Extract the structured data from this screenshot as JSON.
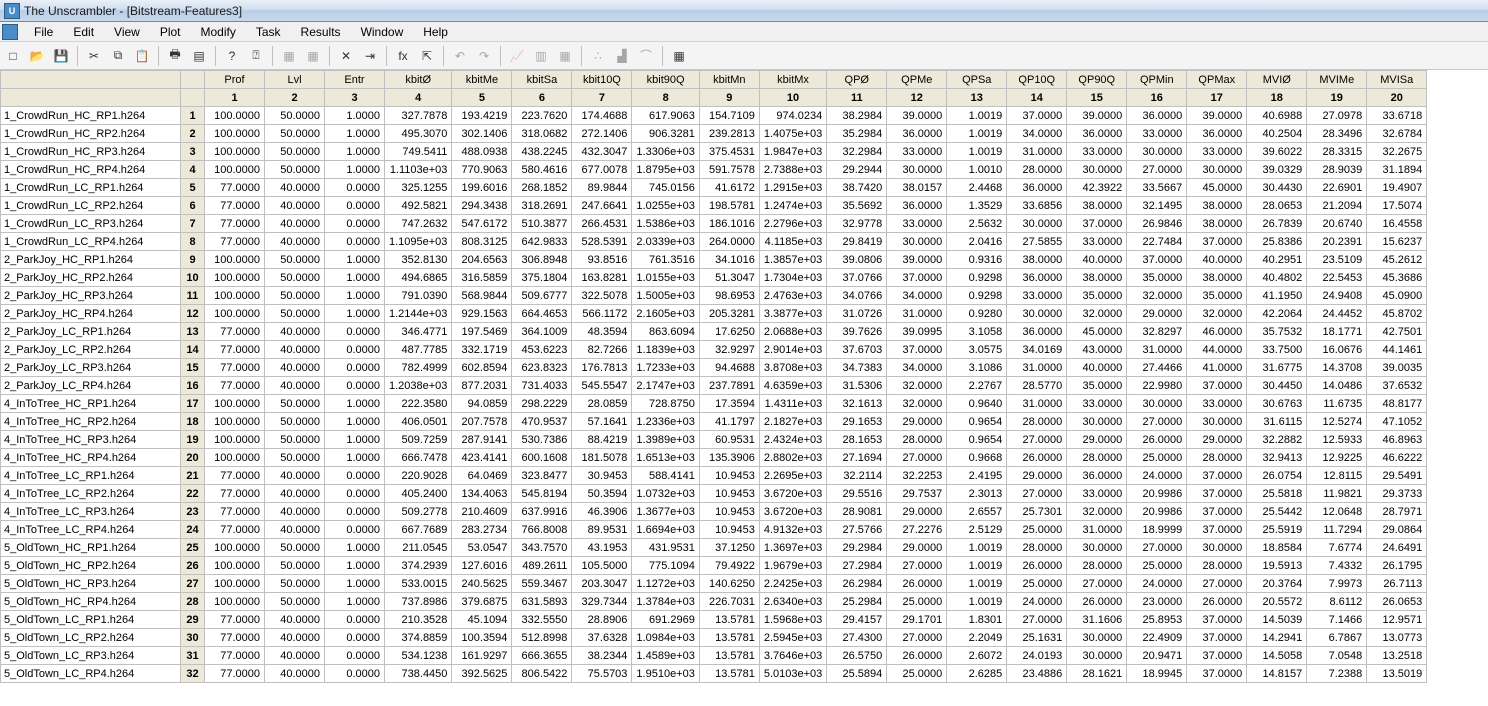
{
  "app": {
    "title": "The Unscrambler - [Bitstream-Features3]"
  },
  "menu": [
    "File",
    "Edit",
    "View",
    "Plot",
    "Modify",
    "Task",
    "Results",
    "Window",
    "Help"
  ],
  "toolbar_icons": [
    {
      "name": "new-icon",
      "glyph": "□"
    },
    {
      "name": "open-icon",
      "glyph": "📂"
    },
    {
      "name": "save-icon",
      "glyph": "💾"
    },
    {
      "name": "sep"
    },
    {
      "name": "cut-icon",
      "glyph": "✂"
    },
    {
      "name": "copy-icon",
      "glyph": "⧉"
    },
    {
      "name": "paste-icon",
      "glyph": "📋"
    },
    {
      "name": "sep"
    },
    {
      "name": "print-icon",
      "glyph": "🖶"
    },
    {
      "name": "print-preview-icon",
      "glyph": "▤"
    },
    {
      "name": "sep"
    },
    {
      "name": "help-icon",
      "glyph": "?"
    },
    {
      "name": "context-help-icon",
      "glyph": "⍰"
    },
    {
      "name": "sep"
    },
    {
      "name": "grid-a-icon",
      "glyph": "▦",
      "disabled": true
    },
    {
      "name": "grid-b-icon",
      "glyph": "▦",
      "disabled": true
    },
    {
      "name": "sep"
    },
    {
      "name": "delete-x-icon",
      "glyph": "✕"
    },
    {
      "name": "insert-col-icon",
      "glyph": "⇥"
    },
    {
      "name": "sep"
    },
    {
      "name": "fx-icon",
      "glyph": "fx"
    },
    {
      "name": "export-icon",
      "glyph": "⇱"
    },
    {
      "name": "sep"
    },
    {
      "name": "undo-icon",
      "glyph": "↶",
      "disabled": true
    },
    {
      "name": "redo-icon",
      "glyph": "↷",
      "disabled": true
    },
    {
      "name": "sep"
    },
    {
      "name": "chart-line-icon",
      "glyph": "📈",
      "disabled": true
    },
    {
      "name": "chart-bar-icon",
      "glyph": "▥",
      "disabled": true
    },
    {
      "name": "chart-matrix-icon",
      "glyph": "▦",
      "disabled": true
    },
    {
      "name": "sep"
    },
    {
      "name": "scatter-icon",
      "glyph": "∴",
      "disabled": true
    },
    {
      "name": "histogram-icon",
      "glyph": "▟",
      "disabled": true
    },
    {
      "name": "normal-icon",
      "glyph": "⌒",
      "disabled": true
    },
    {
      "name": "sep"
    },
    {
      "name": "table-select-icon",
      "glyph": "▦"
    }
  ],
  "columns": [
    {
      "name": "Prof",
      "idx": "1",
      "w": "col-w-mid"
    },
    {
      "name": "Lvl",
      "idx": "2",
      "w": "col-w-mid"
    },
    {
      "name": "Entr",
      "idx": "3",
      "w": "col-w-mid"
    },
    {
      "name": "kbitØ",
      "idx": "4",
      "w": "col-w-wide"
    },
    {
      "name": "kbitMe",
      "idx": "5",
      "w": "col-w-mid"
    },
    {
      "name": "kbitSa",
      "idx": "6",
      "w": "col-w-mid"
    },
    {
      "name": "kbit10Q",
      "idx": "7",
      "w": "col-w-mid"
    },
    {
      "name": "kbit90Q",
      "idx": "8",
      "w": "col-w-wide"
    },
    {
      "name": "kbitMn",
      "idx": "9",
      "w": "col-w-mid"
    },
    {
      "name": "kbitMx",
      "idx": "10",
      "w": "col-w-wide"
    },
    {
      "name": "QPØ",
      "idx": "11",
      "w": "col-w-mid"
    },
    {
      "name": "QPMe",
      "idx": "12",
      "w": "col-w-nar"
    },
    {
      "name": "QPSa",
      "idx": "13",
      "w": "col-w-nar"
    },
    {
      "name": "QP10Q",
      "idx": "14",
      "w": "col-w-nar"
    },
    {
      "name": "QP90Q",
      "idx": "15",
      "w": "col-w-nar"
    },
    {
      "name": "QPMin",
      "idx": "16",
      "w": "col-w-nar"
    },
    {
      "name": "QPMax",
      "idx": "17",
      "w": "col-w-nar"
    },
    {
      "name": "MVIØ",
      "idx": "18",
      "w": "col-w-nar"
    },
    {
      "name": "MVIMe",
      "idx": "19",
      "w": "col-w-nar"
    },
    {
      "name": "MVISa",
      "idx": "20",
      "w": "col-w-nar"
    }
  ],
  "rows": [
    {
      "n": "1_CrowdRun_HC_RP1.h264",
      "i": "1",
      "v": [
        "100.0000",
        "50.0000",
        "1.0000",
        "327.7878",
        "193.4219",
        "223.7620",
        "174.4688",
        "617.9063",
        "154.7109",
        "974.0234",
        "38.2984",
        "39.0000",
        "1.0019",
        "37.0000",
        "39.0000",
        "36.0000",
        "39.0000",
        "40.6988",
        "27.0978",
        "33.6718"
      ]
    },
    {
      "n": "1_CrowdRun_HC_RP2.h264",
      "i": "2",
      "v": [
        "100.0000",
        "50.0000",
        "1.0000",
        "495.3070",
        "302.1406",
        "318.0682",
        "272.1406",
        "906.3281",
        "239.2813",
        "1.4075e+03",
        "35.2984",
        "36.0000",
        "1.0019",
        "34.0000",
        "36.0000",
        "33.0000",
        "36.0000",
        "40.2504",
        "28.3496",
        "32.6784"
      ]
    },
    {
      "n": "1_CrowdRun_HC_RP3.h264",
      "i": "3",
      "v": [
        "100.0000",
        "50.0000",
        "1.0000",
        "749.5411",
        "488.0938",
        "438.2245",
        "432.3047",
        "1.3306e+03",
        "375.4531",
        "1.9847e+03",
        "32.2984",
        "33.0000",
        "1.0019",
        "31.0000",
        "33.0000",
        "30.0000",
        "33.0000",
        "39.6022",
        "28.3315",
        "32.2675"
      ]
    },
    {
      "n": "1_CrowdRun_HC_RP4.h264",
      "i": "4",
      "v": [
        "100.0000",
        "50.0000",
        "1.0000",
        "1.1103e+03",
        "770.9063",
        "580.4616",
        "677.0078",
        "1.8795e+03",
        "591.7578",
        "2.7388e+03",
        "29.2944",
        "30.0000",
        "1.0010",
        "28.0000",
        "30.0000",
        "27.0000",
        "30.0000",
        "39.0329",
        "28.9039",
        "31.1894"
      ]
    },
    {
      "n": "1_CrowdRun_LC_RP1.h264",
      "i": "5",
      "v": [
        "77.0000",
        "40.0000",
        "0.0000",
        "325.1255",
        "199.6016",
        "268.1852",
        "89.9844",
        "745.0156",
        "41.6172",
        "1.2915e+03",
        "38.7420",
        "38.0157",
        "2.4468",
        "36.0000",
        "42.3922",
        "33.5667",
        "45.0000",
        "30.4430",
        "22.6901",
        "19.4907"
      ]
    },
    {
      "n": "1_CrowdRun_LC_RP2.h264",
      "i": "6",
      "v": [
        "77.0000",
        "40.0000",
        "0.0000",
        "492.5821",
        "294.3438",
        "318.2691",
        "247.6641",
        "1.0255e+03",
        "198.5781",
        "1.2474e+03",
        "35.5692",
        "36.0000",
        "1.3529",
        "33.6856",
        "38.0000",
        "32.1495",
        "38.0000",
        "28.0653",
        "21.2094",
        "17.5074"
      ]
    },
    {
      "n": "1_CrowdRun_LC_RP3.h264",
      "i": "7",
      "v": [
        "77.0000",
        "40.0000",
        "0.0000",
        "747.2632",
        "547.6172",
        "510.3877",
        "266.4531",
        "1.5386e+03",
        "186.1016",
        "2.2796e+03",
        "32.9778",
        "33.0000",
        "2.5632",
        "30.0000",
        "37.0000",
        "26.9846",
        "38.0000",
        "26.7839",
        "20.6740",
        "16.4558"
      ]
    },
    {
      "n": "1_CrowdRun_LC_RP4.h264",
      "i": "8",
      "v": [
        "77.0000",
        "40.0000",
        "0.0000",
        "1.1095e+03",
        "808.3125",
        "642.9833",
        "528.5391",
        "2.0339e+03",
        "264.0000",
        "4.1185e+03",
        "29.8419",
        "30.0000",
        "2.0416",
        "27.5855",
        "33.0000",
        "22.7484",
        "37.0000",
        "25.8386",
        "20.2391",
        "15.6237"
      ]
    },
    {
      "n": "2_ParkJoy_HC_RP1.h264",
      "i": "9",
      "v": [
        "100.0000",
        "50.0000",
        "1.0000",
        "352.8130",
        "204.6563",
        "306.8948",
        "93.8516",
        "761.3516",
        "34.1016",
        "1.3857e+03",
        "39.0806",
        "39.0000",
        "0.9316",
        "38.0000",
        "40.0000",
        "37.0000",
        "40.0000",
        "40.2951",
        "23.5109",
        "45.2612"
      ]
    },
    {
      "n": "2_ParkJoy_HC_RP2.h264",
      "i": "10",
      "v": [
        "100.0000",
        "50.0000",
        "1.0000",
        "494.6865",
        "316.5859",
        "375.1804",
        "163.8281",
        "1.0155e+03",
        "51.3047",
        "1.7304e+03",
        "37.0766",
        "37.0000",
        "0.9298",
        "36.0000",
        "38.0000",
        "35.0000",
        "38.0000",
        "40.4802",
        "22.5453",
        "45.3686"
      ]
    },
    {
      "n": "2_ParkJoy_HC_RP3.h264",
      "i": "11",
      "v": [
        "100.0000",
        "50.0000",
        "1.0000",
        "791.0390",
        "568.9844",
        "509.6777",
        "322.5078",
        "1.5005e+03",
        "98.6953",
        "2.4763e+03",
        "34.0766",
        "34.0000",
        "0.9298",
        "33.0000",
        "35.0000",
        "32.0000",
        "35.0000",
        "41.1950",
        "24.9408",
        "45.0900"
      ]
    },
    {
      "n": "2_ParkJoy_HC_RP4.h264",
      "i": "12",
      "v": [
        "100.0000",
        "50.0000",
        "1.0000",
        "1.2144e+03",
        "929.1563",
        "664.4653",
        "566.1172",
        "2.1605e+03",
        "205.3281",
        "3.3877e+03",
        "31.0726",
        "31.0000",
        "0.9280",
        "30.0000",
        "32.0000",
        "29.0000",
        "32.0000",
        "42.2064",
        "24.4452",
        "45.8702"
      ]
    },
    {
      "n": "2_ParkJoy_LC_RP1.h264",
      "i": "13",
      "v": [
        "77.0000",
        "40.0000",
        "0.0000",
        "346.4771",
        "197.5469",
        "364.1009",
        "48.3594",
        "863.6094",
        "17.6250",
        "2.0688e+03",
        "39.7626",
        "39.0995",
        "3.1058",
        "36.0000",
        "45.0000",
        "32.8297",
        "46.0000",
        "35.7532",
        "18.1771",
        "42.7501"
      ]
    },
    {
      "n": "2_ParkJoy_LC_RP2.h264",
      "i": "14",
      "v": [
        "77.0000",
        "40.0000",
        "0.0000",
        "487.7785",
        "332.1719",
        "453.6223",
        "82.7266",
        "1.1839e+03",
        "32.9297",
        "2.9014e+03",
        "37.6703",
        "37.0000",
        "3.0575",
        "34.0169",
        "43.0000",
        "31.0000",
        "44.0000",
        "33.7500",
        "16.0676",
        "44.1461"
      ]
    },
    {
      "n": "2_ParkJoy_LC_RP3.h264",
      "i": "15",
      "v": [
        "77.0000",
        "40.0000",
        "0.0000",
        "782.4999",
        "602.8594",
        "623.8323",
        "176.7813",
        "1.7233e+03",
        "94.4688",
        "3.8708e+03",
        "34.7383",
        "34.0000",
        "3.1086",
        "31.0000",
        "40.0000",
        "27.4466",
        "41.0000",
        "31.6775",
        "14.3708",
        "39.0035"
      ]
    },
    {
      "n": "2_ParkJoy_LC_RP4.h264",
      "i": "16",
      "v": [
        "77.0000",
        "40.0000",
        "0.0000",
        "1.2038e+03",
        "877.2031",
        "731.4033",
        "545.5547",
        "2.1747e+03",
        "237.7891",
        "4.6359e+03",
        "31.5306",
        "32.0000",
        "2.2767",
        "28.5770",
        "35.0000",
        "22.9980",
        "37.0000",
        "30.4450",
        "14.0486",
        "37.6532"
      ]
    },
    {
      "n": "4_InToTree_HC_RP1.h264",
      "i": "17",
      "v": [
        "100.0000",
        "50.0000",
        "1.0000",
        "222.3580",
        "94.0859",
        "298.2229",
        "28.0859",
        "728.8750",
        "17.3594",
        "1.4311e+03",
        "32.1613",
        "32.0000",
        "0.9640",
        "31.0000",
        "33.0000",
        "30.0000",
        "33.0000",
        "30.6763",
        "11.6735",
        "48.8177"
      ]
    },
    {
      "n": "4_InToTree_HC_RP2.h264",
      "i": "18",
      "v": [
        "100.0000",
        "50.0000",
        "1.0000",
        "406.0501",
        "207.7578",
        "470.9537",
        "57.1641",
        "1.2336e+03",
        "41.1797",
        "2.1827e+03",
        "29.1653",
        "29.0000",
        "0.9654",
        "28.0000",
        "30.0000",
        "27.0000",
        "30.0000",
        "31.6115",
        "12.5274",
        "47.1052"
      ]
    },
    {
      "n": "4_InToTree_HC_RP3.h264",
      "i": "19",
      "v": [
        "100.0000",
        "50.0000",
        "1.0000",
        "509.7259",
        "287.9141",
        "530.7386",
        "88.4219",
        "1.3989e+03",
        "60.9531",
        "2.4324e+03",
        "28.1653",
        "28.0000",
        "0.9654",
        "27.0000",
        "29.0000",
        "26.0000",
        "29.0000",
        "32.2882",
        "12.5933",
        "46.8963"
      ]
    },
    {
      "n": "4_InToTree_HC_RP4.h264",
      "i": "20",
      "v": [
        "100.0000",
        "50.0000",
        "1.0000",
        "666.7478",
        "423.4141",
        "600.1608",
        "181.5078",
        "1.6513e+03",
        "135.3906",
        "2.8802e+03",
        "27.1694",
        "27.0000",
        "0.9668",
        "26.0000",
        "28.0000",
        "25.0000",
        "28.0000",
        "32.9413",
        "12.9225",
        "46.6222"
      ]
    },
    {
      "n": "4_InToTree_LC_RP1.h264",
      "i": "21",
      "v": [
        "77.0000",
        "40.0000",
        "0.0000",
        "220.9028",
        "64.0469",
        "323.8477",
        "30.9453",
        "588.4141",
        "10.9453",
        "2.2695e+03",
        "32.2114",
        "32.2253",
        "2.4195",
        "29.0000",
        "36.0000",
        "24.0000",
        "37.0000",
        "26.0754",
        "12.8115",
        "29.5491"
      ]
    },
    {
      "n": "4_InToTree_LC_RP2.h264",
      "i": "22",
      "v": [
        "77.0000",
        "40.0000",
        "0.0000",
        "405.2400",
        "134.4063",
        "545.8194",
        "50.3594",
        "1.0732e+03",
        "10.9453",
        "3.6720e+03",
        "29.5516",
        "29.7537",
        "2.3013",
        "27.0000",
        "33.0000",
        "20.9986",
        "37.0000",
        "25.5818",
        "11.9821",
        "29.3733"
      ]
    },
    {
      "n": "4_InToTree_LC_RP3.h264",
      "i": "23",
      "v": [
        "77.0000",
        "40.0000",
        "0.0000",
        "509.2778",
        "210.4609",
        "637.9916",
        "46.3906",
        "1.3677e+03",
        "10.9453",
        "3.6720e+03",
        "28.9081",
        "29.0000",
        "2.6557",
        "25.7301",
        "32.0000",
        "20.9986",
        "37.0000",
        "25.5442",
        "12.0648",
        "28.7971"
      ]
    },
    {
      "n": "4_InToTree_LC_RP4.h264",
      "i": "24",
      "v": [
        "77.0000",
        "40.0000",
        "0.0000",
        "667.7689",
        "283.2734",
        "766.8008",
        "89.9531",
        "1.6694e+03",
        "10.9453",
        "4.9132e+03",
        "27.5766",
        "27.2276",
        "2.5129",
        "25.0000",
        "31.0000",
        "18.9999",
        "37.0000",
        "25.5919",
        "11.7294",
        "29.0864"
      ]
    },
    {
      "n": "5_OldTown_HC_RP1.h264",
      "i": "25",
      "v": [
        "100.0000",
        "50.0000",
        "1.0000",
        "211.0545",
        "53.0547",
        "343.7570",
        "43.1953",
        "431.9531",
        "37.1250",
        "1.3697e+03",
        "29.2984",
        "29.0000",
        "1.0019",
        "28.0000",
        "30.0000",
        "27.0000",
        "30.0000",
        "18.8584",
        "7.6774",
        "24.6491"
      ]
    },
    {
      "n": "5_OldTown_HC_RP2.h264",
      "i": "26",
      "v": [
        "100.0000",
        "50.0000",
        "1.0000",
        "374.2939",
        "127.6016",
        "489.2611",
        "105.5000",
        "775.1094",
        "79.4922",
        "1.9679e+03",
        "27.2984",
        "27.0000",
        "1.0019",
        "26.0000",
        "28.0000",
        "25.0000",
        "28.0000",
        "19.5913",
        "7.4332",
        "26.1795"
      ]
    },
    {
      "n": "5_OldTown_HC_RP3.h264",
      "i": "27",
      "v": [
        "100.0000",
        "50.0000",
        "1.0000",
        "533.0015",
        "240.5625",
        "559.3467",
        "203.3047",
        "1.1272e+03",
        "140.6250",
        "2.2425e+03",
        "26.2984",
        "26.0000",
        "1.0019",
        "25.0000",
        "27.0000",
        "24.0000",
        "27.0000",
        "20.3764",
        "7.9973",
        "26.7113"
      ]
    },
    {
      "n": "5_OldTown_HC_RP4.h264",
      "i": "28",
      "v": [
        "100.0000",
        "50.0000",
        "1.0000",
        "737.8986",
        "379.6875",
        "631.5893",
        "329.7344",
        "1.3784e+03",
        "226.7031",
        "2.6340e+03",
        "25.2984",
        "25.0000",
        "1.0019",
        "24.0000",
        "26.0000",
        "23.0000",
        "26.0000",
        "20.5572",
        "8.6112",
        "26.0653"
      ]
    },
    {
      "n": "5_OldTown_LC_RP1.h264",
      "i": "29",
      "v": [
        "77.0000",
        "40.0000",
        "0.0000",
        "210.3528",
        "45.1094",
        "332.5550",
        "28.8906",
        "691.2969",
        "13.5781",
        "1.5968e+03",
        "29.4157",
        "29.1701",
        "1.8301",
        "27.0000",
        "31.1606",
        "25.8953",
        "37.0000",
        "14.5039",
        "7.1466",
        "12.9571"
      ]
    },
    {
      "n": "5_OldTown_LC_RP2.h264",
      "i": "30",
      "v": [
        "77.0000",
        "40.0000",
        "0.0000",
        "374.8859",
        "100.3594",
        "512.8998",
        "37.6328",
        "1.0984e+03",
        "13.5781",
        "2.5945e+03",
        "27.4300",
        "27.0000",
        "2.2049",
        "25.1631",
        "30.0000",
        "22.4909",
        "37.0000",
        "14.2941",
        "6.7867",
        "13.0773"
      ]
    },
    {
      "n": "5_OldTown_LC_RP3.h264",
      "i": "31",
      "v": [
        "77.0000",
        "40.0000",
        "0.0000",
        "534.1238",
        "161.9297",
        "666.3655",
        "38.2344",
        "1.4589e+03",
        "13.5781",
        "3.7646e+03",
        "26.5750",
        "26.0000",
        "2.6072",
        "24.0193",
        "30.0000",
        "20.9471",
        "37.0000",
        "14.5058",
        "7.0548",
        "13.2518"
      ]
    },
    {
      "n": "5_OldTown_LC_RP4.h264",
      "i": "32",
      "v": [
        "77.0000",
        "40.0000",
        "0.0000",
        "738.4450",
        "392.5625",
        "806.5422",
        "75.5703",
        "1.9510e+03",
        "13.5781",
        "5.0103e+03",
        "25.5894",
        "25.0000",
        "2.6285",
        "23.4886",
        "28.1621",
        "18.9945",
        "37.0000",
        "14.8157",
        "7.2388",
        "13.5019"
      ]
    }
  ]
}
